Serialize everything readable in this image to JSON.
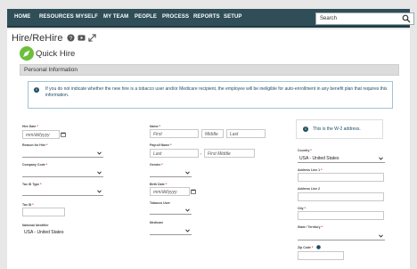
{
  "nav": {
    "items": [
      "HOME",
      "RESOURCES",
      "MYSELF",
      "MY TEAM",
      "PEOPLE",
      "PROCESS",
      "REPORTS",
      "SETUP"
    ],
    "search_placeholder": "Search"
  },
  "page": {
    "title": "Hire/ReHire",
    "quick_label": "Quick Hire",
    "section_title": "Personal Information",
    "info_text": "If you do not indicate whether the new hire is a tobacco user and/or Medicare recipient, the employee will be ineligible for auto-enrollment in any benefit plan that requires this information."
  },
  "form": {
    "hire_date_label": "Hire Date",
    "hire_date_ph": "mm/dd/yyyy",
    "reason_label": "Reason for Hire",
    "company_code_label": "Company Code",
    "tax_id_type_label": "Tax ID Type",
    "tax_id_label": "Tax ID",
    "national_id_label": "National Identifier",
    "national_id_value": "USA - United States",
    "name_label": "Name",
    "first_ph": "First",
    "middle_ph": "Middle",
    "last_ph": "Last",
    "payroll_name_label": "Payroll Name",
    "payroll_last_ph": "Last",
    "payroll_first_ph": "First Middle",
    "payroll_comma": ",",
    "gender_label": "Gender",
    "birth_date_label": "Birth Date",
    "birth_date_ph": "mm/dd/yyyy",
    "tobacco_label": "Tobacco User",
    "medicare_label": "Medicare",
    "w2_text": "This is the W-2 address.",
    "country_label": "Country",
    "country_value": "USA - United States",
    "addr1_label": "Address Line 1",
    "addr2_label": "Address Line 2",
    "city_label": "City",
    "state_label": "State / Territory",
    "zip_label": "Zip Code",
    "required_mark": "*"
  },
  "colors": {
    "nav_bg": "#2f4e58",
    "accent_green": "#6bbf3a",
    "info_blue": "#1f4c64",
    "required": "#cc0000"
  }
}
